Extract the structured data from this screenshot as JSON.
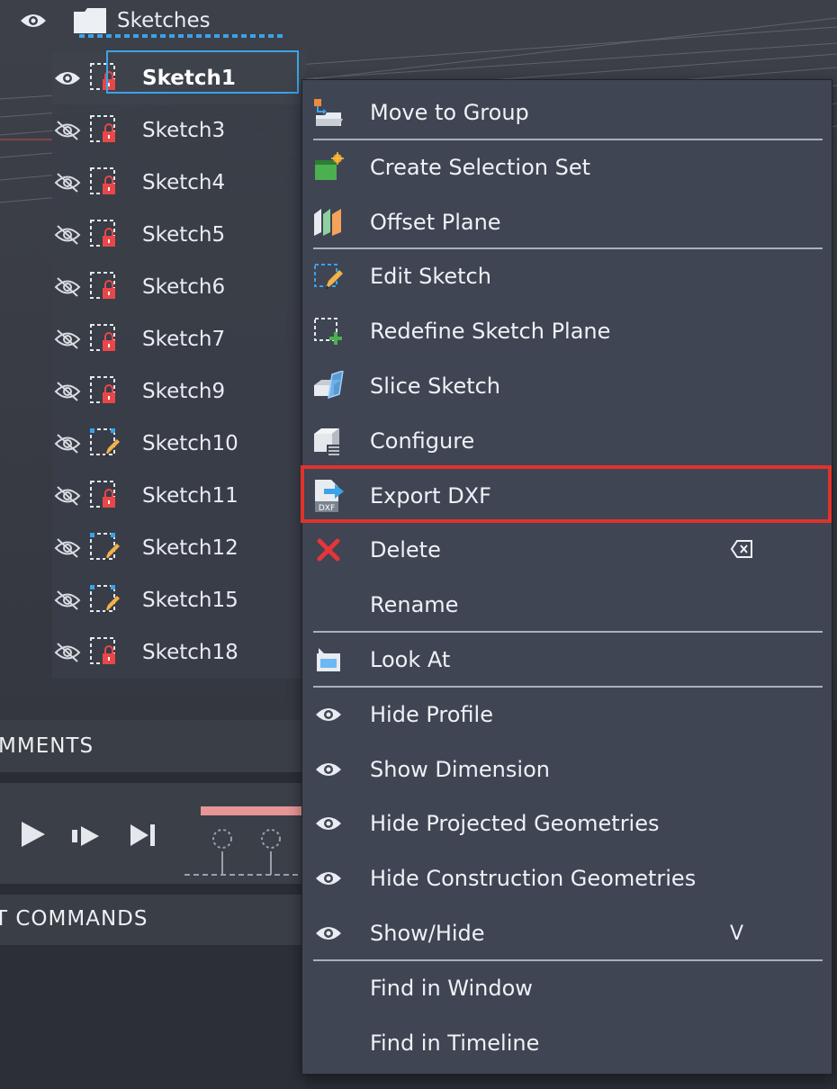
{
  "browser": {
    "folder_label": "Sketches",
    "items": [
      {
        "label": "Sketch1",
        "visible": true,
        "icon": "sketch-locked-icon",
        "selected": true
      },
      {
        "label": "Sketch3",
        "visible": false,
        "icon": "sketch-locked-icon"
      },
      {
        "label": "Sketch4",
        "visible": false,
        "icon": "sketch-locked-icon"
      },
      {
        "label": "Sketch5",
        "visible": false,
        "icon": "sketch-locked-icon"
      },
      {
        "label": "Sketch6",
        "visible": false,
        "icon": "sketch-locked-icon"
      },
      {
        "label": "Sketch7",
        "visible": false,
        "icon": "sketch-locked-icon"
      },
      {
        "label": "Sketch9",
        "visible": false,
        "icon": "sketch-locked-icon"
      },
      {
        "label": "Sketch10",
        "visible": false,
        "icon": "sketch-edit-icon"
      },
      {
        "label": "Sketch11",
        "visible": false,
        "icon": "sketch-locked-icon"
      },
      {
        "label": "Sketch12",
        "visible": false,
        "icon": "sketch-edit-icon"
      },
      {
        "label": "Sketch15",
        "visible": false,
        "icon": "sketch-edit-icon"
      },
      {
        "label": "Sketch18",
        "visible": false,
        "icon": "sketch-locked-icon"
      }
    ]
  },
  "panels": {
    "comments_label": "MMENTS",
    "commands_label": "T COMMANDS"
  },
  "context_menu": {
    "items": [
      {
        "label": "Move to Group",
        "icon": "move-to-group-icon"
      },
      {
        "label": "Create Selection Set",
        "icon": "selection-set-icon"
      },
      {
        "label": "Offset Plane",
        "icon": "offset-plane-icon"
      },
      {
        "label": "Edit Sketch",
        "icon": "edit-sketch-icon"
      },
      {
        "label": "Redefine Sketch Plane",
        "icon": "redefine-plane-icon"
      },
      {
        "label": "Slice Sketch",
        "icon": "slice-sketch-icon"
      },
      {
        "label": "Configure",
        "icon": "configure-icon"
      },
      {
        "label": "Export DXF",
        "icon": "export-dxf-icon",
        "highlighted": true,
        "icon_text": "DXF"
      },
      {
        "label": "Delete",
        "icon": "delete-x-icon",
        "shortcut_icon": "backspace-key-icon"
      },
      {
        "label": "Rename",
        "icon": ""
      },
      {
        "label": "Look At",
        "icon": "look-at-icon"
      },
      {
        "label": "Hide Profile",
        "icon": "eye-icon"
      },
      {
        "label": "Show Dimension",
        "icon": "eye-icon"
      },
      {
        "label": "Hide Projected Geometries",
        "icon": "eye-icon"
      },
      {
        "label": "Hide Construction Geometries",
        "icon": "eye-icon"
      },
      {
        "label": "Show/Hide",
        "icon": "eye-icon",
        "shortcut": "V"
      },
      {
        "label": "Find in Window",
        "icon": ""
      },
      {
        "label": "Find in Timeline",
        "icon": ""
      }
    ]
  },
  "colors": {
    "selection": "#3aa3ea",
    "highlight": "#e0332b",
    "lock": "#e8474a",
    "delete": "#e8343a"
  }
}
